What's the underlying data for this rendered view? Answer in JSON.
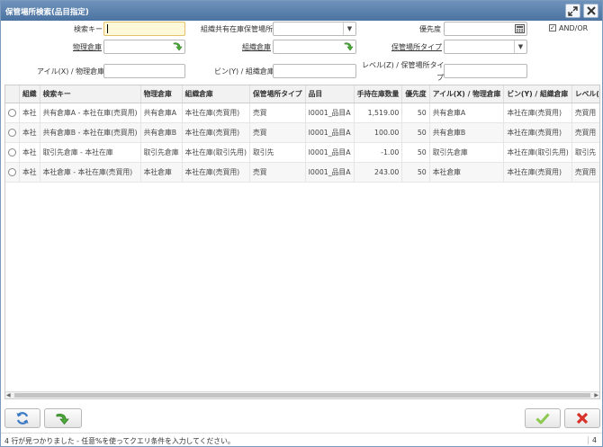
{
  "window": {
    "title": "保管場所検索(品目指定)",
    "maximize_icon": "expand-icon",
    "close_icon": "close-icon"
  },
  "form": {
    "search_key_label": "検索キー",
    "search_key_value": "",
    "shared_locator_label": "組織共有在庫保管場所",
    "shared_locator_value": "",
    "priority_label": "優先度",
    "priority_value": "",
    "and_or_label": "AND/OR",
    "and_or_checked": true,
    "physical_wh_label": "物理倉庫",
    "physical_wh_value": "",
    "org_wh_label": "組織倉庫",
    "org_wh_value": "",
    "locator_type_label": "保管場所タイプ",
    "locator_type_value": "",
    "aisle_label": "アイル(X) / 物理倉庫",
    "aisle_value": "",
    "bin_label": "ビン(Y) / 組織倉庫",
    "bin_value": "",
    "level_label_1": "レベル(Z) / 保管場所タイ",
    "level_label_2": "プ",
    "level_value": ""
  },
  "table": {
    "columns": [
      "",
      "組織",
      "検索キー",
      "物理倉庫",
      "組織倉庫",
      "保管場所タイプ",
      "品目",
      "手持在庫数量",
      "優先度",
      "アイル(X) / 物理倉庫",
      "ビン(Y) / 組織倉庫",
      "レベル(Z) / 保管場所"
    ],
    "rows": [
      [
        "",
        "本社",
        "共有倉庫A - 本社在庫(売買用)",
        "共有倉庫A",
        "本社在庫(売買用)",
        "売買",
        "I0001_品目A",
        "1,519.00",
        "50",
        "共有倉庫A",
        "本社在庫(売買用)",
        "売買用"
      ],
      [
        "",
        "本社",
        "共有倉庫B - 本社在庫(売買用)",
        "共有倉庫B",
        "本社在庫(売買用)",
        "売買",
        "I0001_品目A",
        "100.00",
        "50",
        "共有倉庫B",
        "本社在庫(売買用)",
        "売買用"
      ],
      [
        "",
        "本社",
        "取引先倉庫 - 本社在庫",
        "取引先倉庫",
        "本社在庫(取引先用)",
        "取引先",
        "I0001_品目A",
        "-1.00",
        "50",
        "取引先倉庫",
        "本社在庫(取引先用)",
        "取引先"
      ],
      [
        "",
        "本社",
        "本社倉庫 - 本社在庫(売買用)",
        "本社倉庫",
        "本社在庫(売買用)",
        "売買",
        "I0001_品目A",
        "243.00",
        "50",
        "本社倉庫",
        "本社在庫(売買用)",
        "売買用"
      ]
    ]
  },
  "toolbar": {
    "refresh_icon": "refresh-icon",
    "requery_icon": "requery-icon",
    "ok_icon": "check-icon",
    "cancel_icon": "cancel-icon"
  },
  "status": {
    "message": "4 行が見つかりました - 任意%を使ってクエリ条件を入力してください。",
    "count": "4"
  },
  "colors": {
    "title_bar": "#5a80ad",
    "ok_green": "#7bbf3f",
    "cancel_red": "#d9322b",
    "go_green": "#4caa3a"
  }
}
